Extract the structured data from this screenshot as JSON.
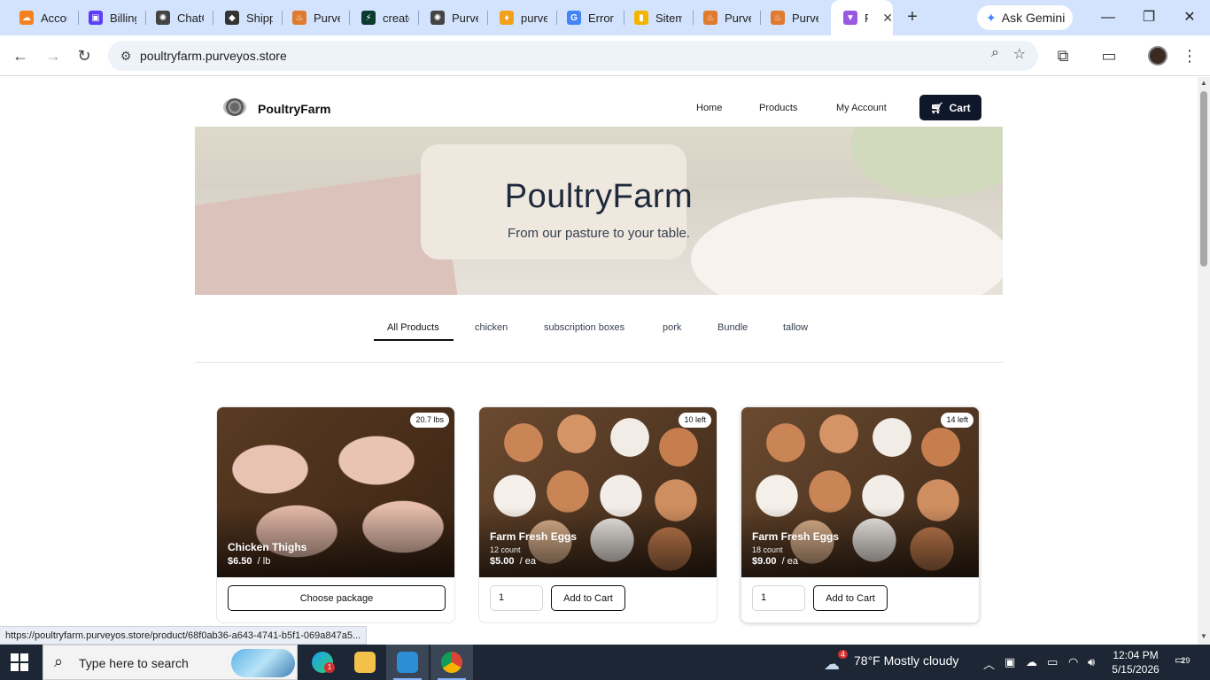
{
  "browser": {
    "tabs": [
      {
        "label": "Accou",
        "fav_color": "#f48120",
        "fav_glyph": "☁"
      },
      {
        "label": "Billing",
        "fav_color": "#5b3df5",
        "fav_glyph": "▣"
      },
      {
        "label": "ChatG",
        "fav_color": "#444444",
        "fav_glyph": "✺"
      },
      {
        "label": "Shipp",
        "fav_color": "#333333",
        "fav_glyph": "◆"
      },
      {
        "label": "Purve",
        "fav_color": "#e07a2e",
        "fav_glyph": "♨"
      },
      {
        "label": "create",
        "fav_color": "#0b3b2e",
        "fav_glyph": "⚡"
      },
      {
        "label": "Purve",
        "fav_color": "#444444",
        "fav_glyph": "✺"
      },
      {
        "label": "purve",
        "fav_color": "#f2a11a",
        "fav_glyph": "♦"
      },
      {
        "label": "Error",
        "fav_color": "#4285f4",
        "fav_glyph": "G"
      },
      {
        "label": "Sitem",
        "fav_color": "#f4b400",
        "fav_glyph": "▮"
      },
      {
        "label": "Purve",
        "fav_color": "#e07a2e",
        "fav_glyph": "♨"
      },
      {
        "label": "Purve",
        "fav_color": "#e07a2e",
        "fav_glyph": "♨"
      },
      {
        "label": "P",
        "fav_color": "#9b59e0",
        "fav_glyph": "▼"
      }
    ],
    "ask_gemini": "Ask Gemini",
    "url": "poultryfarm.purveyos.store",
    "status_url": "https://poultryfarm.purveyos.store/product/68f0ab36-a643-4741-b5f1-069a847a5..."
  },
  "site": {
    "brand": "PoultryFarm",
    "nav": {
      "home": "Home",
      "products": "Products",
      "account": "My Account",
      "cart": "Cart"
    },
    "hero": {
      "title": "PoultryFarm",
      "subtitle": "From our pasture to your table."
    },
    "categories": [
      "All Products",
      "chicken",
      "subscription boxes",
      "pork",
      "Bundle",
      "tallow"
    ],
    "active_category": "All Products",
    "products": [
      {
        "name": "Chicken Thighs",
        "badge": "20.7 lbs",
        "count": "",
        "price": "$6.50",
        "unit": "/ lb",
        "action": "Choose package"
      },
      {
        "name": "Farm Fresh Eggs",
        "badge": "10 left",
        "count": "12 count",
        "price": "$5.00",
        "unit": "/ ea",
        "qty": "1",
        "action": "Add to Cart"
      },
      {
        "name": "Farm Fresh Eggs",
        "badge": "14 left",
        "count": "18 count",
        "price": "$9.00",
        "unit": "/ ea",
        "qty": "1",
        "action": "Add to Cart"
      }
    ]
  },
  "taskbar": {
    "search_placeholder": "Type here to search",
    "weather_badge": "4",
    "weather": "78°F  Mostly cloudy",
    "time": "12:04 PM",
    "date": "5/15/2026",
    "notifications": "29",
    "chrome_badge": "1"
  },
  "colors": {
    "accent": "#0f172a",
    "tab_strip": "#d3e3fd",
    "taskbar": "#1c2634"
  }
}
